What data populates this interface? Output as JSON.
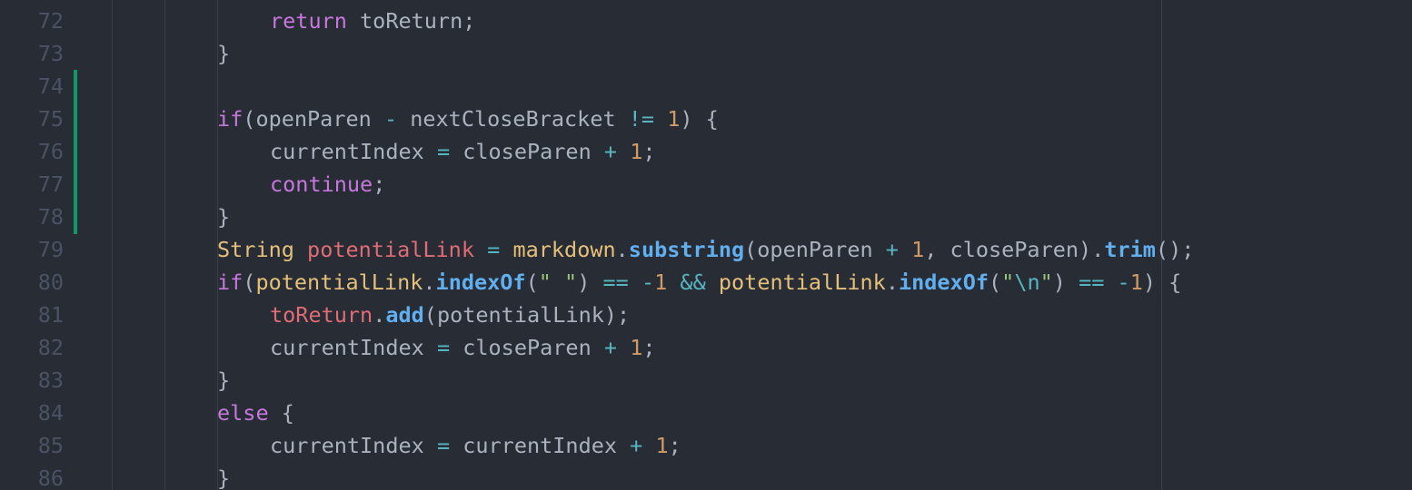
{
  "editor": {
    "lines": [
      {
        "n": "72",
        "indent": 4,
        "tokens": [
          [
            "kw",
            "return"
          ],
          [
            "pl",
            " toReturn;"
          ]
        ],
        "changed": false
      },
      {
        "n": "73",
        "indent": 3,
        "tokens": [
          [
            "pl",
            "}"
          ]
        ],
        "changed": false
      },
      {
        "n": "74",
        "indent": 0,
        "tokens": [],
        "changed": true
      },
      {
        "n": "75",
        "indent": 3,
        "tokens": [
          [
            "kw",
            "if"
          ],
          [
            "pl",
            "(openParen "
          ],
          [
            "op",
            "-"
          ],
          [
            "pl",
            " nextCloseBracket "
          ],
          [
            "op",
            "!="
          ],
          [
            "pl",
            " "
          ],
          [
            "num",
            "1"
          ],
          [
            "pl",
            ") {"
          ]
        ],
        "changed": true
      },
      {
        "n": "76",
        "indent": 4,
        "tokens": [
          [
            "pl",
            "currentIndex "
          ],
          [
            "op",
            "="
          ],
          [
            "pl",
            " closeParen "
          ],
          [
            "op",
            "+"
          ],
          [
            "pl",
            " "
          ],
          [
            "num",
            "1"
          ],
          [
            "pl",
            ";"
          ]
        ],
        "changed": true
      },
      {
        "n": "77",
        "indent": 4,
        "tokens": [
          [
            "kw",
            "continue"
          ],
          [
            "pl",
            ";"
          ]
        ],
        "changed": true
      },
      {
        "n": "78",
        "indent": 3,
        "tokens": [
          [
            "pl",
            "}"
          ]
        ],
        "changed": true
      },
      {
        "n": "79",
        "indent": 3,
        "tokens": [
          [
            "ty",
            "String"
          ],
          [
            "pl",
            " "
          ],
          [
            "var",
            "potentialLink"
          ],
          [
            "pl",
            " "
          ],
          [
            "op",
            "="
          ],
          [
            "pl",
            " "
          ],
          [
            "ty",
            "markdown"
          ],
          [
            "pl",
            "."
          ],
          [
            "fn",
            "substring"
          ],
          [
            "pl",
            "(openParen "
          ],
          [
            "op",
            "+"
          ],
          [
            "pl",
            " "
          ],
          [
            "num",
            "1"
          ],
          [
            "pl",
            ", closeParen)."
          ],
          [
            "fn",
            "trim"
          ],
          [
            "pl",
            "();"
          ]
        ],
        "changed": false
      },
      {
        "n": "80",
        "indent": 3,
        "tokens": [
          [
            "kw",
            "if"
          ],
          [
            "pl",
            "("
          ],
          [
            "ty",
            "potentialLink"
          ],
          [
            "pl",
            "."
          ],
          [
            "fn",
            "indexOf"
          ],
          [
            "pl",
            "("
          ],
          [
            "str",
            "\" \""
          ],
          [
            "pl",
            ") "
          ],
          [
            "op",
            "=="
          ],
          [
            "pl",
            " "
          ],
          [
            "op",
            "-"
          ],
          [
            "num",
            "1"
          ],
          [
            "pl",
            " "
          ],
          [
            "op",
            "&&"
          ],
          [
            "pl",
            " "
          ],
          [
            "ty",
            "potentialLink"
          ],
          [
            "pl",
            "."
          ],
          [
            "fn",
            "indexOf"
          ],
          [
            "pl",
            "("
          ],
          [
            "str",
            "\""
          ],
          [
            "esc",
            "\\n"
          ],
          [
            "str",
            "\""
          ],
          [
            "pl",
            ") "
          ],
          [
            "op",
            "=="
          ],
          [
            "pl",
            " "
          ],
          [
            "op",
            "-"
          ],
          [
            "num",
            "1"
          ],
          [
            "pl",
            ") {"
          ]
        ],
        "changed": false
      },
      {
        "n": "81",
        "indent": 4,
        "tokens": [
          [
            "var",
            "toReturn"
          ],
          [
            "pl",
            "."
          ],
          [
            "fn",
            "add"
          ],
          [
            "pl",
            "(potentialLink);"
          ]
        ],
        "changed": false
      },
      {
        "n": "82",
        "indent": 4,
        "tokens": [
          [
            "pl",
            "currentIndex "
          ],
          [
            "op",
            "="
          ],
          [
            "pl",
            " closeParen "
          ],
          [
            "op",
            "+"
          ],
          [
            "pl",
            " "
          ],
          [
            "num",
            "1"
          ],
          [
            "pl",
            ";"
          ]
        ],
        "changed": false
      },
      {
        "n": "83",
        "indent": 3,
        "tokens": [
          [
            "pl",
            "}"
          ]
        ],
        "changed": false
      },
      {
        "n": "84",
        "indent": 3,
        "tokens": [
          [
            "kw",
            "else"
          ],
          [
            "pl",
            " {"
          ]
        ],
        "changed": false
      },
      {
        "n": "85",
        "indent": 4,
        "tokens": [
          [
            "pl",
            "currentIndex "
          ],
          [
            "op",
            "="
          ],
          [
            "pl",
            " currentIndex "
          ],
          [
            "op",
            "+"
          ],
          [
            "pl",
            " "
          ],
          [
            "num",
            "1"
          ],
          [
            "pl",
            ";"
          ]
        ],
        "changed": false
      },
      {
        "n": "86",
        "indent": 3,
        "tokens": [
          [
            "pl",
            "}"
          ]
        ],
        "changed": false
      }
    ]
  },
  "colors": {
    "background": "#282c34",
    "line_number": "#4b5263",
    "keyword": "#c678dd",
    "type": "#e5c07b",
    "variable": "#e06c75",
    "function": "#61afef",
    "number": "#d19a66",
    "operator": "#56b6c2",
    "string": "#98c379",
    "plain": "#abb2bf",
    "git_added": "#109868"
  }
}
